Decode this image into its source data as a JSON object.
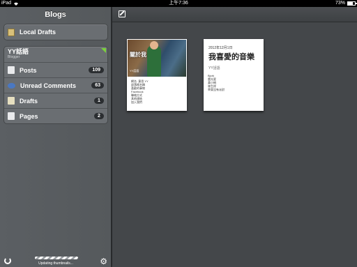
{
  "status": {
    "device": "iPad",
    "time": "上午7:36",
    "battery": "73%"
  },
  "sidebar": {
    "title": "Blogs",
    "local_drafts": "Local Drafts",
    "blog": {
      "name": "YY話語",
      "platform": "Blogger",
      "items": [
        {
          "label": "Posts",
          "count": "109"
        },
        {
          "label": "Unread Comments",
          "count": "63"
        },
        {
          "label": "Drafts",
          "count": "1"
        },
        {
          "label": "Pages",
          "count": "2"
        }
      ]
    },
    "footer": {
      "status": "Updating thumbnails..."
    }
  },
  "posts": [
    {
      "photo_title": "關於我",
      "photo_subtitle": "YY話語",
      "lines": [
        "網名: 意思 YY",
        "部落格名稱",
        "喜歡的事物",
        "Facebook",
        "聯絡方式",
        "其他連結",
        "加入我們"
      ]
    },
    {
      "date": "2012年12月1日",
      "title": "我喜愛的音樂",
      "author": "YY話語",
      "lines": [
        "Bjork",
        "雷光夏",
        "黃小楨",
        "林生祥",
        "草東沒有派對"
      ]
    }
  ]
}
